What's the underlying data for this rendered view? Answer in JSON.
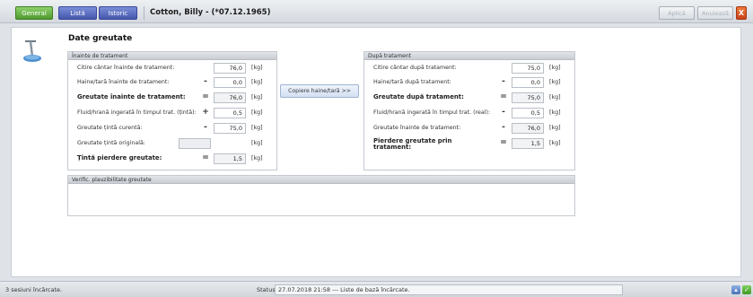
{
  "tabs": {
    "general": "General",
    "list": "Listă",
    "history": "Istoric"
  },
  "patient": {
    "title": "Cotton, Billy - (*07.12.1965)"
  },
  "toolbar": {
    "apply": "Aplică",
    "cancel": "Anulează",
    "close": "X"
  },
  "page": {
    "title": "Date greutate"
  },
  "before": {
    "header": "Înainte de tratament",
    "rows": [
      {
        "label": "Citire cântar înainte de tratament:",
        "op": "",
        "value": "76,0",
        "unit": "[kg]"
      },
      {
        "label": "Haine/tară înainte de tratament:",
        "op": "-",
        "value": "0,0",
        "unit": "[kg]"
      },
      {
        "label": "Greutate înainte de tratament:",
        "op": "=",
        "value": "76,0",
        "unit": "[kg]"
      },
      {
        "label": "Fluid/hrană ingerată în timpul trat. (țintă):",
        "op": "+",
        "value": "0,5",
        "unit": "[kg]"
      },
      {
        "label": "Greutate țintă curentă:",
        "op": "-",
        "value": "75,0",
        "unit": "[kg]"
      },
      {
        "label": "Greutate țintă originală:",
        "op": "",
        "value": "",
        "unit": "[kg]"
      },
      {
        "label": "Țintă pierdere greutate:",
        "op": "=",
        "value": "1,5",
        "unit": "[kg]"
      }
    ]
  },
  "copy_button": "Copiere haine/tară >>",
  "after": {
    "header": "După tratament",
    "rows": [
      {
        "label": "Citire cântar după tratament:",
        "op": "",
        "value": "75,0",
        "unit": "[kg]"
      },
      {
        "label": "Haine/tară după tratament:",
        "op": "-",
        "value": "0,0",
        "unit": "[kg]"
      },
      {
        "label": "Greutate după tratament:",
        "op": "=",
        "value": "75,0",
        "unit": "[kg]"
      },
      {
        "label": "Fluid/hrană ingerată în timpul trat. (real):",
        "op": "-",
        "value": "0,5",
        "unit": "[kg]"
      },
      {
        "label": "Greutate înainte de tratament:",
        "op": "-",
        "value": "76,0",
        "unit": "[kg]"
      },
      {
        "label": "Pierdere greutate prin",
        "label2": "tratament:",
        "op": "=",
        "value": "1,5",
        "unit": "[kg]"
      }
    ]
  },
  "verify": {
    "header": "Verific. plauzibilitate greutate"
  },
  "status": {
    "left": "3 sesiuni încărcate.",
    "label": "Status:",
    "message": "27.07.2018 21:58 --- Liste de bază încărcate."
  },
  "colors": {
    "general_tab": "#5aa838",
    "list_tab": "#4a5cb5",
    "close": "#e05a25",
    "accent_field_bg": "#eef4fd"
  }
}
